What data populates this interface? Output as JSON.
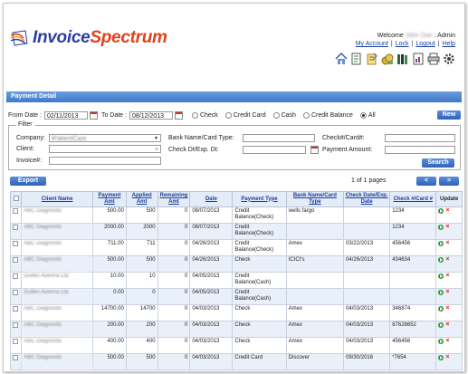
{
  "header": {
    "logo_part1": "Invoice",
    "logo_part2": "Spectrum",
    "welcome_prefix": "Welcome",
    "user_name": "John Doe",
    "welcome_role": ": Admin",
    "links": [
      "My Account",
      "Lock",
      "Logout",
      "Help"
    ],
    "icons": [
      "home-icon",
      "invoice-icon",
      "notes-icon",
      "payment-icon",
      "books-icon",
      "reports-icon",
      "print-icon",
      "settings-icon"
    ]
  },
  "page_title": "Payment Detail",
  "date_filter": {
    "from_label": "From Date :",
    "from_value": "02/11/2013",
    "to_label": "To Date :",
    "to_value": "08/12/2013",
    "options": [
      "Check",
      "Credit Card",
      "Cash",
      "Credit Balance",
      "All"
    ],
    "selected": "All",
    "new_label": "New"
  },
  "filter": {
    "legend": "Filter",
    "company_label": "Company:",
    "company_value": "iPatientCare",
    "client_label": "Client:",
    "invoice_label": "Invoice#:",
    "bank_label": "Bank Name/Card Type:",
    "checkdt_label": "Check Dt/Exp. Dt:",
    "checkno_label": "Check#/Card#:",
    "amount_label": "Payment Amount:",
    "search_label": "Search"
  },
  "toolbar": {
    "export_label": "Export",
    "pages_text": "1 of 1 pages",
    "prev_label": "<",
    "next_label": ">"
  },
  "table": {
    "headers": [
      "Client Name",
      "Payment Amt",
      "Applied Amt",
      "Remaining Amt",
      "Date",
      "Payment Type",
      "Bank Name/Card Type",
      "Check Date/Exp. Date",
      "Check #/Card #",
      "Update"
    ],
    "rows": [
      {
        "client": "ABC Diagnostic",
        "payment": "500.00",
        "applied": "500",
        "remaining": "0",
        "date": "08/07/2013",
        "type": "Credit Balance(Check)",
        "bank": "wells fargo",
        "checkdate": "",
        "checkno": "1234"
      },
      {
        "client": "ABC Diagnostic",
        "payment": "2000.00",
        "applied": "2000",
        "remaining": "0",
        "date": "08/07/2013",
        "type": "Credit Balance(Check)",
        "bank": "",
        "checkdate": "",
        "checkno": "1234"
      },
      {
        "client": "ABC Diagnostic",
        "payment": "711.00",
        "applied": "711",
        "remaining": "0",
        "date": "04/26/2013",
        "type": "Credit Balance(Check)",
        "bank": "Amex",
        "checkdate": "03/22/2013",
        "checkno": "456456"
      },
      {
        "client": "ABC Diagnostic",
        "payment": "500.00",
        "applied": "500",
        "remaining": "0",
        "date": "04/26/2013",
        "type": "Check",
        "bank": "ICICI's",
        "checkdate": "04/26/2013",
        "checkno": "434634"
      },
      {
        "client": "Gullen Avenna Ltd.",
        "payment": "10.00",
        "applied": "10",
        "remaining": "0",
        "date": "04/05/2013",
        "type": "Credit Balance(Cash)",
        "bank": "",
        "checkdate": "",
        "checkno": ""
      },
      {
        "client": "Gullen Avenna Ltd.",
        "payment": "0.00",
        "applied": "0",
        "remaining": "0",
        "date": "04/05/2013",
        "type": "Credit Balance(Cash)",
        "bank": "",
        "checkdate": "",
        "checkno": ""
      },
      {
        "client": "ABC Diagnostic",
        "payment": "14700.00",
        "applied": "14700",
        "remaining": "0",
        "date": "04/03/2013",
        "type": "Check",
        "bank": "Amex",
        "checkdate": "04/03/2013",
        "checkno": "346874"
      },
      {
        "client": "ABC Diagnostic",
        "payment": "200.00",
        "applied": "200",
        "remaining": "0",
        "date": "04/03/2013",
        "type": "Check",
        "bank": "Amex",
        "checkdate": "04/03/2013",
        "checkno": "87628652"
      },
      {
        "client": "ABC Diagnostic",
        "payment": "400.00",
        "applied": "400",
        "remaining": "0",
        "date": "04/03/2013",
        "type": "Check",
        "bank": "Amex",
        "checkdate": "04/03/2013",
        "checkno": "456456"
      },
      {
        "client": "ABC Diagnostic",
        "payment": "500.00",
        "applied": "500",
        "remaining": "0",
        "date": "04/03/2013",
        "type": "Credit Card",
        "bank": "Discover",
        "checkdate": "09/30/2016",
        "checkno": "*7654"
      }
    ]
  },
  "colors": {
    "accent": "#3f78c9",
    "link": "#1a3f9e",
    "logo_blue": "#2a3fa0",
    "logo_orange": "#e0411c",
    "row_alt": "#e9f0f9"
  }
}
